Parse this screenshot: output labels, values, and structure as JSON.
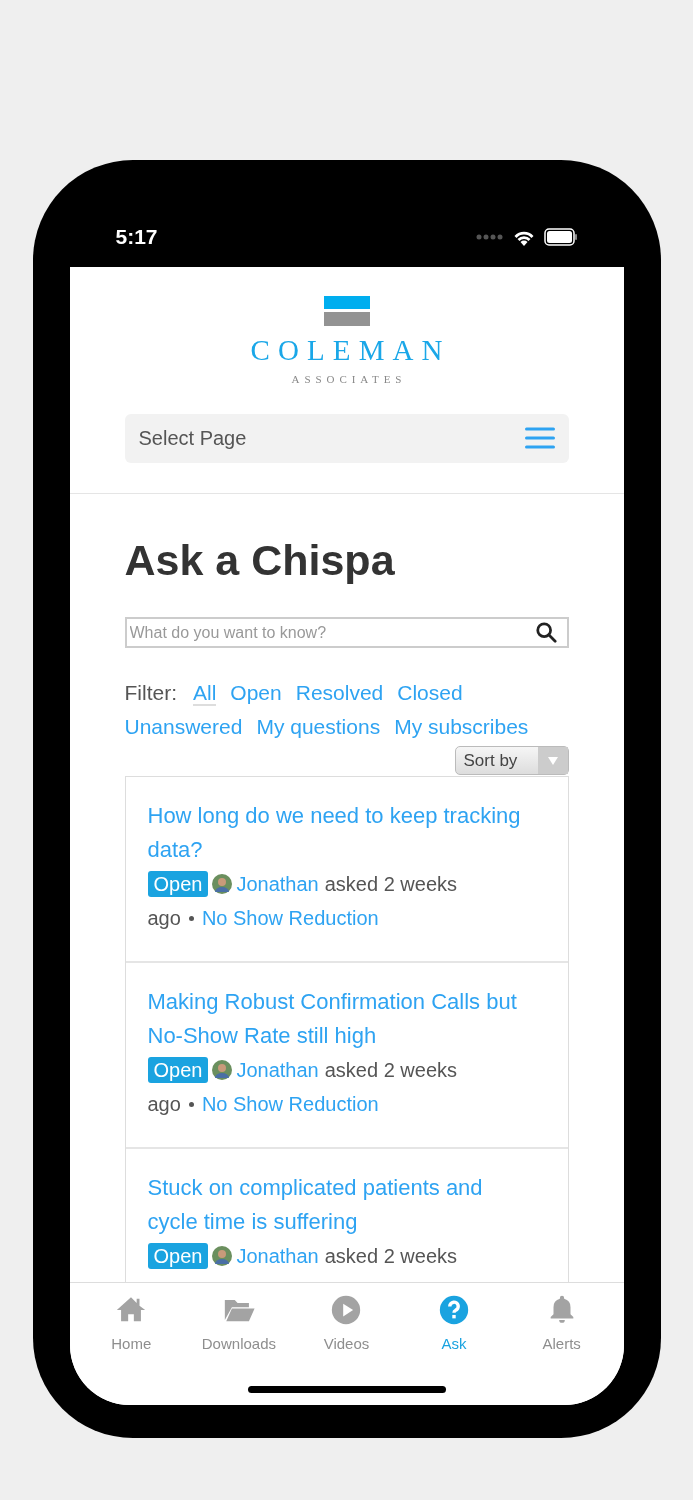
{
  "status_bar": {
    "time": "5:17"
  },
  "logo": {
    "name": "COLEMAN",
    "tagline": "ASSOCIATES"
  },
  "nav": {
    "label": "Select Page"
  },
  "page_title": "Ask a Chispa",
  "search": {
    "placeholder": "What do you want to know?"
  },
  "filter": {
    "label": "Filter:",
    "options": [
      {
        "label": "All",
        "selected": true
      },
      {
        "label": "Open",
        "selected": false
      },
      {
        "label": "Resolved",
        "selected": false
      },
      {
        "label": "Closed",
        "selected": false
      },
      {
        "label": "Unanswered",
        "selected": false
      },
      {
        "label": "My questions",
        "selected": false
      },
      {
        "label": "My subscribes",
        "selected": false
      }
    ]
  },
  "sort": {
    "label": "Sort by"
  },
  "questions": [
    {
      "title": "How long do we need to keep tracking data?",
      "status": "Open",
      "asker": "Jonathan",
      "asked": "asked 2 weeks",
      "ago": "ago",
      "category": "No Show Reduction"
    },
    {
      "title": "Making Robust Confirmation Calls but No-Show Rate still high",
      "status": "Open",
      "asker": "Jonathan",
      "asked": "asked 2 weeks",
      "ago": "ago",
      "category": "No Show Reduction"
    },
    {
      "title": "Stuck on complicated patients and cycle time is suffering",
      "status": "Open",
      "asker": "Jonathan",
      "asked": "asked 2 weeks"
    }
  ],
  "tab_bar": [
    {
      "kind": "home",
      "label": "Home",
      "selected": false
    },
    {
      "kind": "downloads",
      "label": "Downloads",
      "selected": false
    },
    {
      "kind": "videos",
      "label": "Videos",
      "selected": false
    },
    {
      "kind": "ask",
      "label": "Ask",
      "selected": true
    },
    {
      "kind": "alerts",
      "label": "Alerts",
      "selected": false
    }
  ]
}
